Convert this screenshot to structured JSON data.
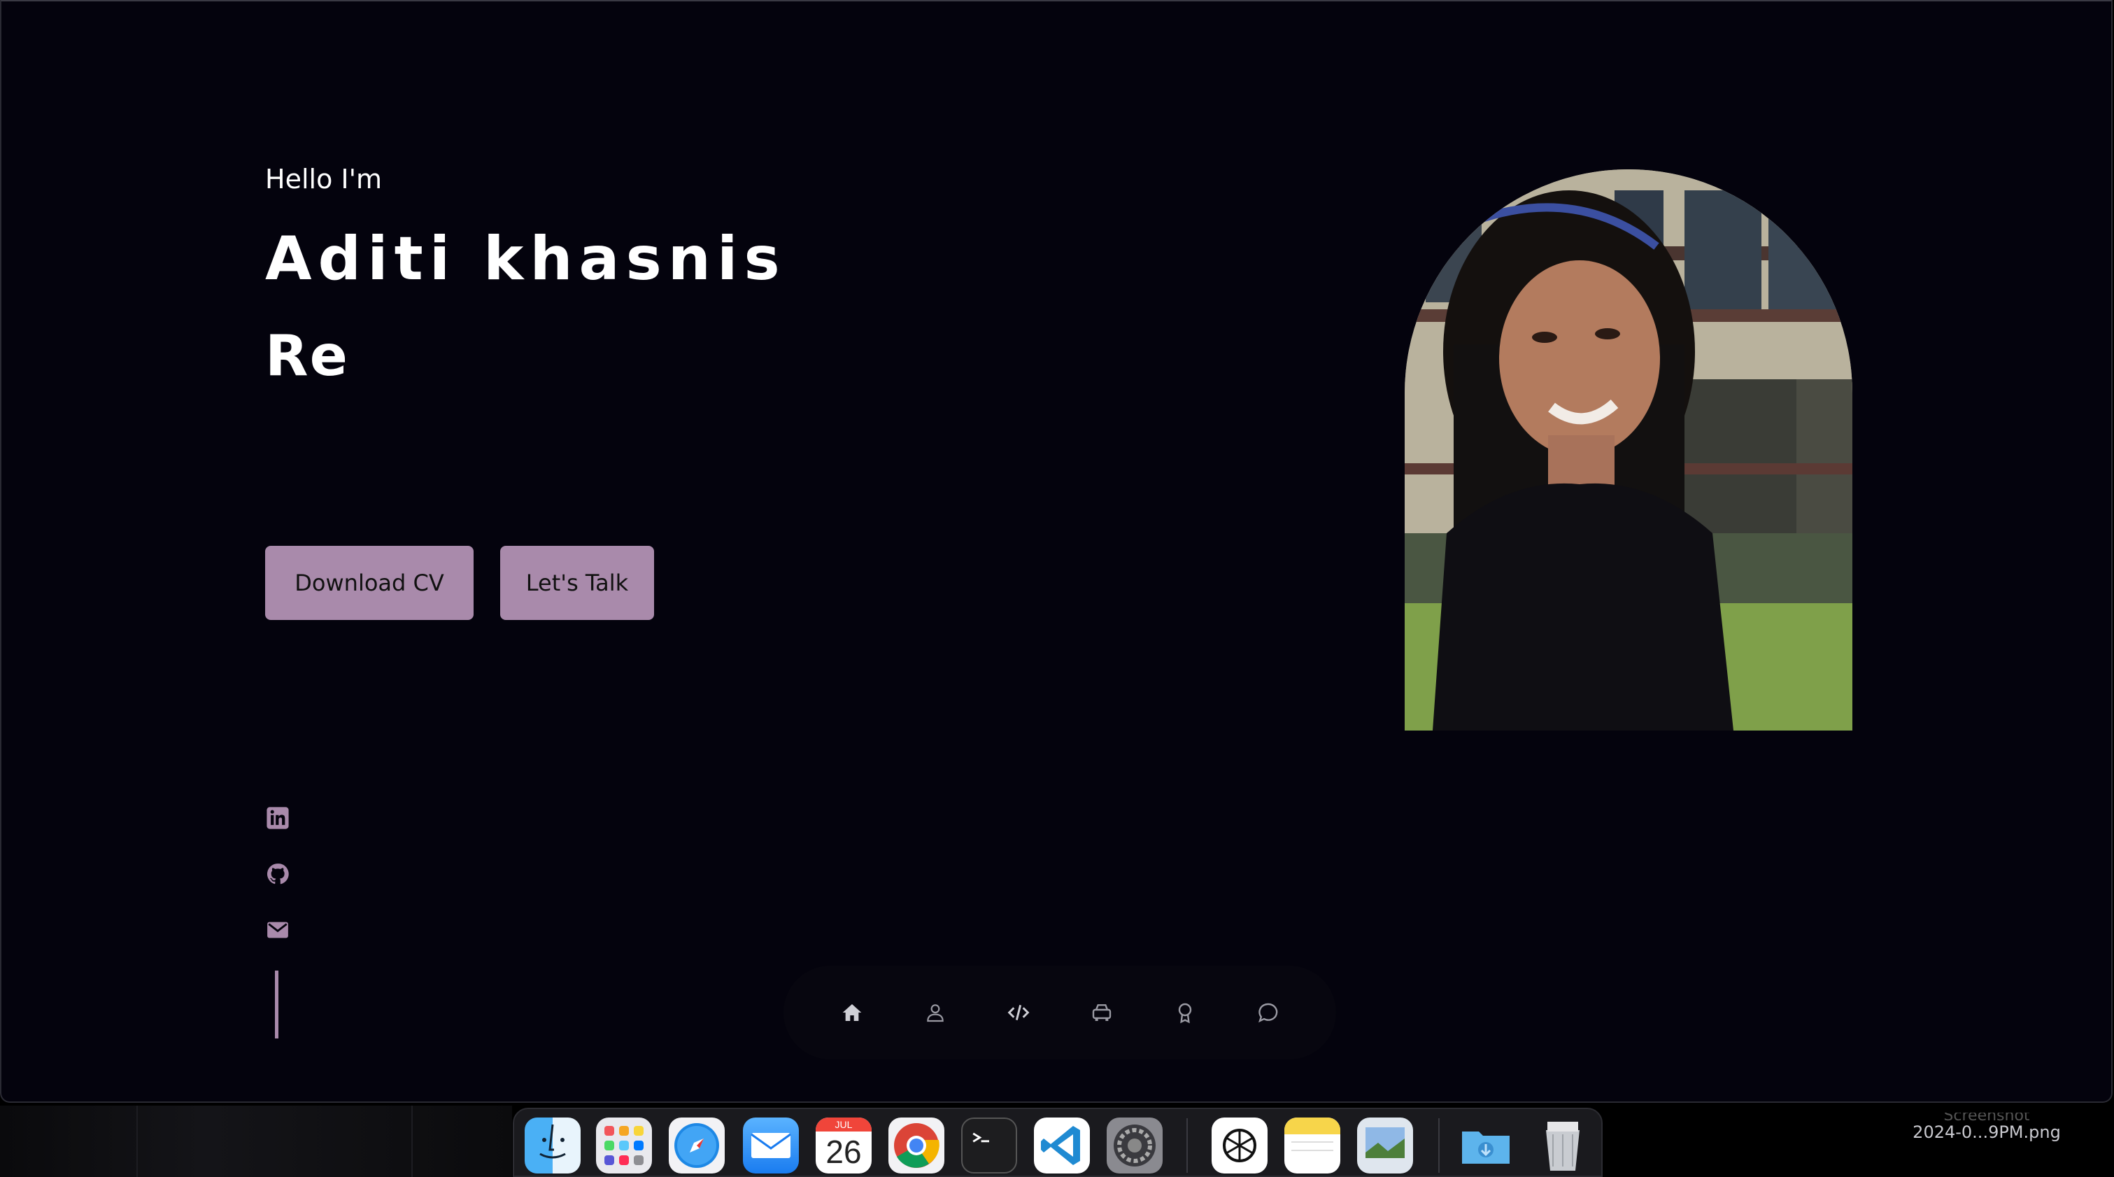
{
  "hero": {
    "greeting": "Hello I'm",
    "name": "Aditi khasnis",
    "role_typed": "Re"
  },
  "buttons": {
    "download_cv": "Download CV",
    "lets_talk": "Let's Talk"
  },
  "social": [
    {
      "icon": "linkedin-icon"
    },
    {
      "icon": "github-icon"
    },
    {
      "icon": "mail-icon"
    }
  ],
  "nav": [
    {
      "icon": "home-icon",
      "active": true
    },
    {
      "icon": "user-icon",
      "active": false
    },
    {
      "icon": "code-icon",
      "active": false
    },
    {
      "icon": "briefcase-icon",
      "active": false
    },
    {
      "icon": "award-icon",
      "active": false
    },
    {
      "icon": "message-icon",
      "active": false
    }
  ],
  "dock": {
    "apps": [
      "finder",
      "launchpad",
      "safari",
      "mail",
      "calendar",
      "chrome",
      "terminal",
      "vscode",
      "system-settings",
      "chatgpt",
      "notes",
      "preview",
      "downloads",
      "trash"
    ],
    "calendar_month": "JUL",
    "calendar_day": "26"
  },
  "desktop": {
    "file_label_top": "Screenshot",
    "file_label": "2024-0...9PM.png"
  },
  "colors": {
    "accent": "#a98aab",
    "background": "#04030d"
  }
}
